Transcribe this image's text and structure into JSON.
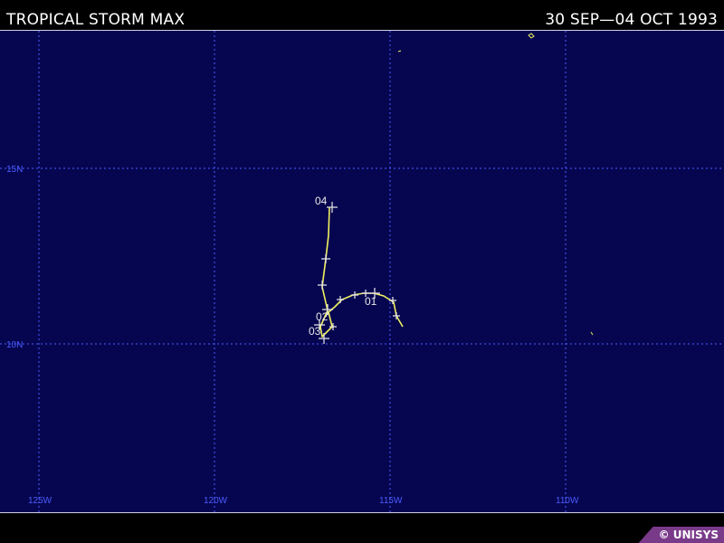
{
  "header": {
    "title": "TROPICAL STORM MAX",
    "dates": "30 SEP—04 OCT 1993"
  },
  "map": {
    "longitude_labels": [
      "125W",
      "120W",
      "115W",
      "110W"
    ],
    "latitude_labels": [
      "15N",
      "10N"
    ],
    "grid_color": "#4a5cff",
    "background_color": "#060650",
    "track_color": "#f0f060",
    "day_labels": [
      "01",
      "02",
      "03",
      "04"
    ]
  },
  "badge": {
    "text": "© UNISYS",
    "color": "#7a3a8a"
  }
}
